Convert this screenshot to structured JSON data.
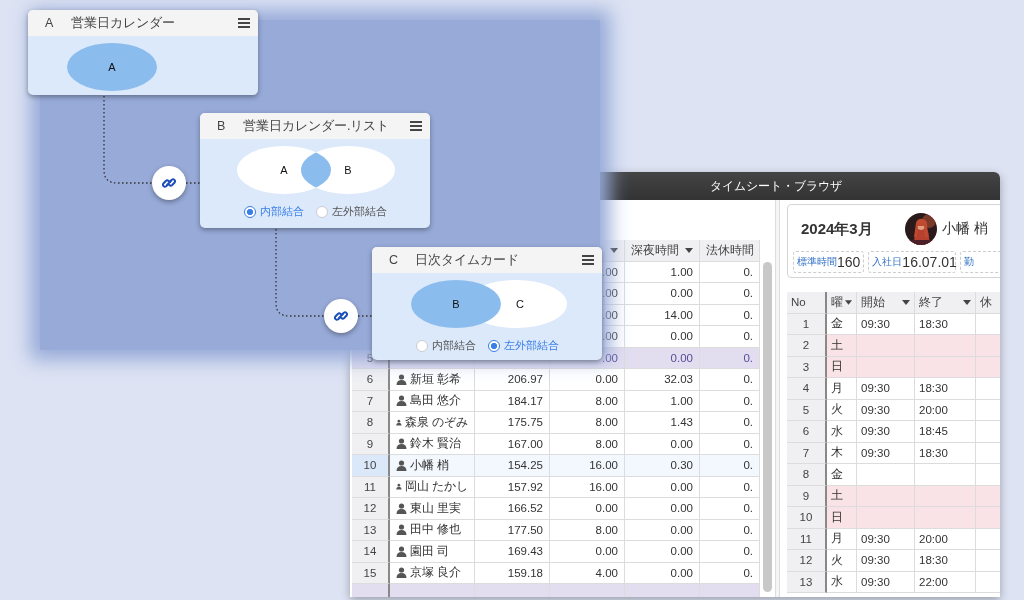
{
  "canvas": {
    "nodes": [
      {
        "letter": "A",
        "title": "営業日カレンダー",
        "kind": "single",
        "sets": [
          "A"
        ]
      },
      {
        "letter": "B",
        "title": "営業日カレンダー.リスト",
        "kind": "join",
        "sets": [
          "A",
          "B"
        ],
        "options": [
          {
            "label": "内部結合",
            "selected": true
          },
          {
            "label": "左外部結合",
            "selected": false
          }
        ]
      },
      {
        "letter": "C",
        "title": "日次タイムカード",
        "kind": "join",
        "sets": [
          "B",
          "C"
        ],
        "options": [
          {
            "label": "内部結合",
            "selected": false
          },
          {
            "label": "左外部結合",
            "selected": true
          }
        ]
      }
    ]
  },
  "window": {
    "title": "タイムシート・ブラウザ",
    "employee_table": {
      "columns": [
        {
          "dropdown": true
        },
        {
          "label": "深夜時間",
          "dropdown": true
        },
        {
          "label": "法休時間",
          "dropdown": false
        }
      ],
      "rows": [
        {
          "column_4": ".00",
          "late_night": "1.00",
          "legal_holiday": "0.",
          "selected": false,
          "flagged": false
        },
        {
          "column_4": ".00",
          "late_night": "0.00",
          "legal_holiday": "0.",
          "selected": false,
          "flagged": false
        },
        {
          "column_4": ".00",
          "late_night": "14.00",
          "legal_holiday": "0.",
          "selected": false,
          "flagged": false
        },
        {
          "column_4": ".00",
          "late_night": "0.00",
          "legal_holiday": "0.",
          "selected": false,
          "flagged": false
        },
        {
          "no": "5",
          "column_4": ".00",
          "late_night": "0.00",
          "legal_holiday": "0.",
          "selected": false,
          "flagged": true
        },
        {
          "no": "6",
          "name": "新垣 彰希",
          "column_3": "206.97",
          "column_4": "0.00",
          "late_night": "32.03",
          "legal_holiday": "0.",
          "selected": false,
          "flagged": false
        },
        {
          "no": "7",
          "name": "島田 悠介",
          "column_3": "184.17",
          "column_4": "8.00",
          "late_night": "1.00",
          "legal_holiday": "0.",
          "selected": false,
          "flagged": false
        },
        {
          "no": "8",
          "name": "森泉 のぞみ",
          "column_3": "175.75",
          "column_4": "8.00",
          "late_night": "1.43",
          "legal_holiday": "0.",
          "selected": false,
          "flagged": false
        },
        {
          "no": "9",
          "name": "鈴木 賢治",
          "column_3": "167.00",
          "column_4": "8.00",
          "late_night": "0.00",
          "legal_holiday": "0.",
          "selected": false,
          "flagged": false
        },
        {
          "no": "10",
          "name": "小幡 梢",
          "column_3": "154.25",
          "column_4": "16.00",
          "late_night": "0.30",
          "legal_holiday": "0.",
          "selected": true,
          "flagged": false
        },
        {
          "no": "11",
          "name": "岡山 たかし",
          "column_3": "157.92",
          "column_4": "16.00",
          "late_night": "0.00",
          "legal_holiday": "0.",
          "selected": false,
          "flagged": false
        },
        {
          "no": "12",
          "name": "東山 里実",
          "column_3": "166.52",
          "column_4": "0.00",
          "late_night": "0.00",
          "legal_holiday": "0.",
          "selected": false,
          "flagged": false
        },
        {
          "no": "13",
          "name": "田中 修也",
          "column_3": "177.50",
          "column_4": "8.00",
          "late_night": "0.00",
          "legal_holiday": "0.",
          "selected": false,
          "flagged": false
        },
        {
          "no": "14",
          "name": "園田 司",
          "column_3": "169.43",
          "column_4": "0.00",
          "late_night": "0.00",
          "legal_holiday": "0.",
          "selected": false,
          "flagged": false
        },
        {
          "no": "15",
          "name": "京塚 良介",
          "column_3": "159.18",
          "column_4": "4.00",
          "late_night": "0.00",
          "legal_holiday": "0.",
          "selected": false,
          "flagged": false
        },
        {
          "selected": false,
          "flagged": true
        }
      ]
    },
    "summary": {
      "month": "2024年3月",
      "name": "小幡 梢",
      "stats": [
        {
          "label": "標準時間",
          "value": "160"
        },
        {
          "label": "入社日",
          "value": "16.07.01"
        },
        {
          "label": "勤"
        }
      ]
    },
    "day_table": {
      "columns": [
        {
          "label": "No",
          "dropdown": false
        },
        {
          "label": "曜",
          "dropdown": true
        },
        {
          "label": "開始",
          "dropdown": true
        },
        {
          "label": "終了",
          "dropdown": true
        },
        {
          "label": "休",
          "dropdown": false
        }
      ],
      "rows": [
        {
          "no": "1",
          "day": "金",
          "start": "09:30",
          "end": "18:30",
          "weekend": false
        },
        {
          "no": "2",
          "day": "土",
          "weekend": true
        },
        {
          "no": "3",
          "day": "日",
          "weekend": true
        },
        {
          "no": "4",
          "day": "月",
          "start": "09:30",
          "end": "18:30",
          "weekend": false
        },
        {
          "no": "5",
          "day": "火",
          "start": "09:30",
          "end": "20:00",
          "weekend": false
        },
        {
          "no": "6",
          "day": "水",
          "start": "09:30",
          "end": "18:45",
          "weekend": false
        },
        {
          "no": "7",
          "day": "木",
          "start": "09:30",
          "end": "18:30",
          "weekend": false
        },
        {
          "no": "8",
          "day": "金",
          "weekend": false
        },
        {
          "no": "9",
          "day": "土",
          "weekend": true
        },
        {
          "no": "10",
          "day": "日",
          "weekend": true
        },
        {
          "no": "11",
          "day": "月",
          "start": "09:30",
          "end": "20:00",
          "weekend": false
        },
        {
          "no": "12",
          "day": "火",
          "start": "09:30",
          "end": "18:30",
          "weekend": false
        },
        {
          "no": "13",
          "day": "水",
          "start": "09:30",
          "end": "22:00",
          "weekend": false
        }
      ]
    }
  }
}
